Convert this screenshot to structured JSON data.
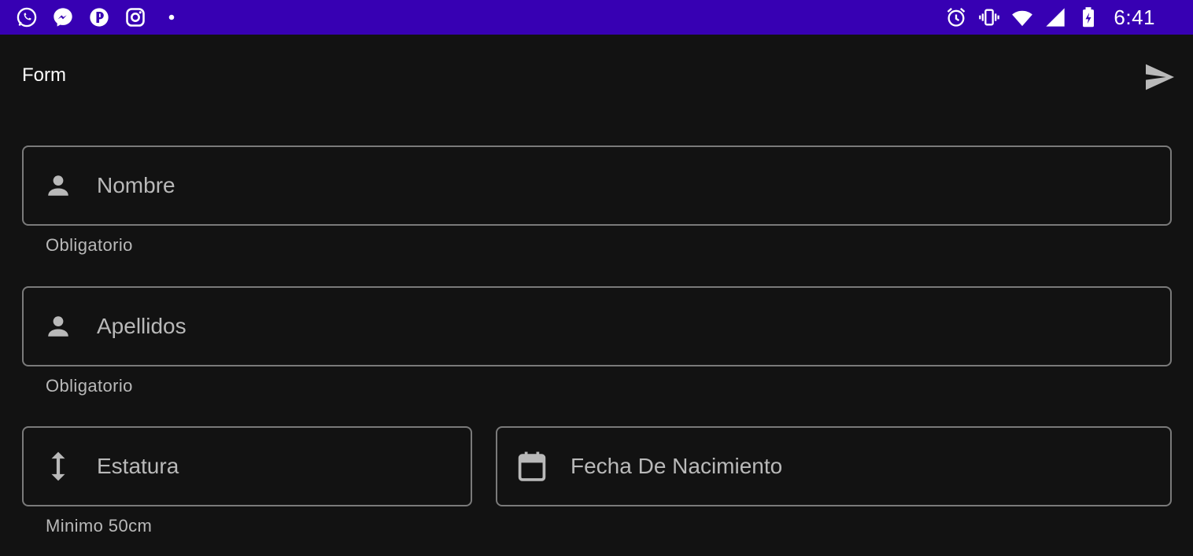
{
  "status_bar": {
    "time": "6:41",
    "left_icons": [
      "whatsapp-icon",
      "messenger-icon",
      "app-p-icon",
      "instagram-icon",
      "notification-dot-icon"
    ],
    "right_icons": [
      "alarm-icon",
      "vibrate-icon",
      "wifi-icon",
      "cell-signal-icon",
      "battery-charging-icon"
    ],
    "color": "#3700b3"
  },
  "toolbar": {
    "title": "Form",
    "send_icon": "send-icon"
  },
  "form": {
    "nombre": {
      "placeholder": "Nombre",
      "value": "",
      "helper": "Obligatorio",
      "icon": "person-icon"
    },
    "apellidos": {
      "placeholder": "Apellidos",
      "value": "",
      "helper": "Obligatorio",
      "icon": "person-icon"
    },
    "estatura": {
      "placeholder": "Estatura",
      "value": "",
      "helper": "Minimo 50cm",
      "icon": "height-arrows-icon"
    },
    "fecha_nacimiento": {
      "placeholder": "Fecha De Nacimiento",
      "value": "",
      "icon": "calendar-icon"
    }
  },
  "colors": {
    "background": "#121212",
    "outline": "#7a7a7a",
    "label": "#b9b9b9"
  }
}
